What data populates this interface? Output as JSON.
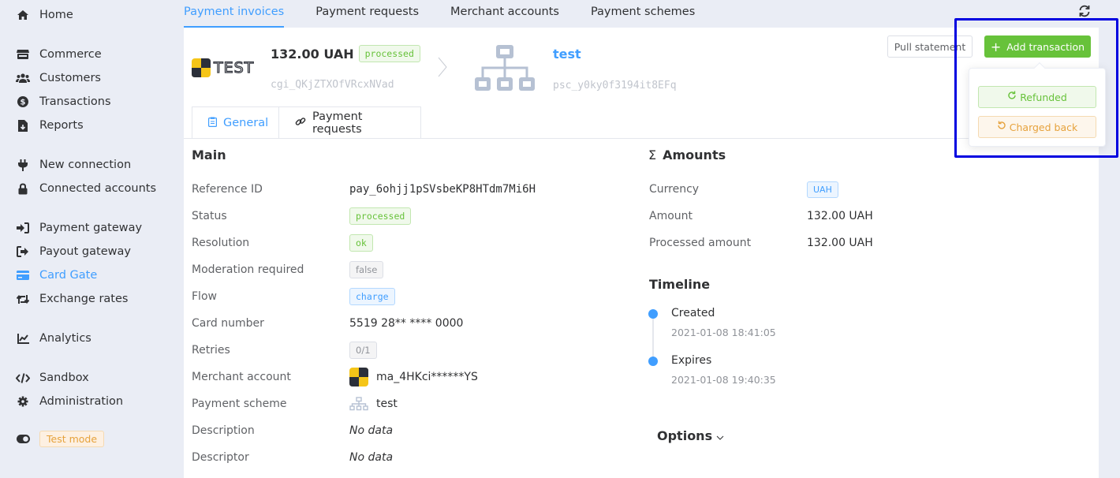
{
  "sidebar": {
    "items": [
      {
        "label": "Home",
        "icon": "home-icon"
      },
      {
        "label": "Commerce",
        "icon": "store-icon"
      },
      {
        "label": "Customers",
        "icon": "users-icon"
      },
      {
        "label": "Transactions",
        "icon": "dollar-circle-icon"
      },
      {
        "label": "Reports",
        "icon": "file-download-icon"
      },
      {
        "label": "New connection",
        "icon": "plug-icon"
      },
      {
        "label": "Connected accounts",
        "icon": "lock-icon"
      },
      {
        "label": "Payment gateway",
        "icon": "sign-in-icon"
      },
      {
        "label": "Payout gateway",
        "icon": "sign-out-icon"
      },
      {
        "label": "Card Gate",
        "icon": "credit-card-icon",
        "active": true
      },
      {
        "label": "Exchange rates",
        "icon": "retweet-icon"
      },
      {
        "label": "Analytics",
        "icon": "chart-line-icon"
      },
      {
        "label": "Sandbox",
        "icon": "code-icon"
      },
      {
        "label": "Administration",
        "icon": "gear-icon"
      }
    ],
    "test_mode": {
      "label": "Test mode",
      "icon": "toggle-icon"
    }
  },
  "top_tabs": [
    {
      "label": "Payment invoices",
      "active": true
    },
    {
      "label": "Payment requests"
    },
    {
      "label": "Merchant accounts"
    },
    {
      "label": "Payment schemes"
    }
  ],
  "header": {
    "logo_text": "TEST",
    "amount": "132.00 UAH",
    "status": "processed",
    "invoice_id": "cgi_QKjZTXOfVRcxNVad",
    "scheme_name": "test",
    "scheme_id": "psc_y0ky0f3194it8EFq",
    "pull_statement": "Pull statement",
    "add_transaction": "Add transaction"
  },
  "popover": {
    "refunded": "Refunded",
    "charged_back": "Charged back"
  },
  "inner_tabs": [
    {
      "label": "General",
      "active": true
    },
    {
      "label": "Payment requests"
    }
  ],
  "main": {
    "title": "Main",
    "rows": [
      {
        "key": "Reference ID",
        "value": "pay_6ohjj1pSVsbeKP8HTdm7Mi6H"
      },
      {
        "key": "Status",
        "value": "processed"
      },
      {
        "key": "Resolution",
        "value": "ok"
      },
      {
        "key": "Moderation required",
        "value": "false"
      },
      {
        "key": "Flow",
        "value": "charge"
      },
      {
        "key": "Card number",
        "value": "5519 28** **** 0000"
      },
      {
        "key": "Retries",
        "value": "0/1"
      },
      {
        "key": "Merchant account",
        "value": "ma_4HKci******YS"
      },
      {
        "key": "Payment scheme",
        "value": "test"
      },
      {
        "key": "Description",
        "value": "No data"
      },
      {
        "key": "Descriptor",
        "value": "No data"
      }
    ]
  },
  "amounts": {
    "title": "Amounts",
    "symbol": "Σ",
    "rows": [
      {
        "key": "Currency",
        "value": "UAH"
      },
      {
        "key": "Amount",
        "value": "132.00 UAH"
      },
      {
        "key": "Processed amount",
        "value": "132.00 UAH"
      }
    ]
  },
  "timeline": {
    "title": "Timeline",
    "events": [
      {
        "title": "Created",
        "time": "2021-01-08 18:41:05"
      },
      {
        "title": "Expires",
        "time": "2021-01-08 19:40:35"
      }
    ]
  },
  "options": {
    "label": "Options"
  },
  "colors": {
    "accent": "#409eff",
    "success": "#67c23a",
    "warning": "#e6a23c",
    "highlight": "#0000e0"
  }
}
